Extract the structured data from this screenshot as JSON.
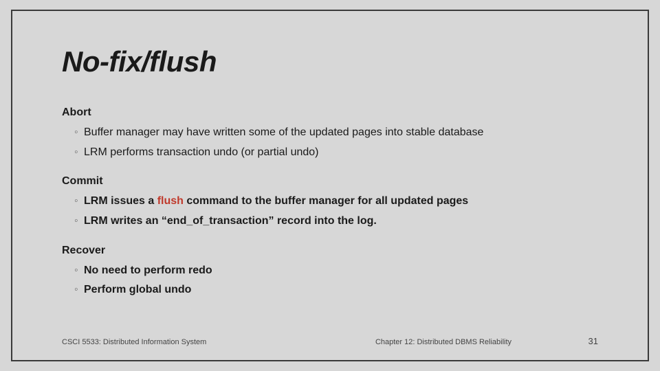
{
  "slide": {
    "title": "No-fix/flush",
    "sections": [
      {
        "heading": "Abort",
        "bullets": [
          {
            "text": "Buffer manager may have written some of the updated pages into stable database"
          },
          {
            "text": "LRM  performs transaction undo (or partial undo)"
          }
        ]
      },
      {
        "heading": "Commit",
        "bullets": [
          {
            "pre": "LRM issues a ",
            "em": "flush",
            "post": " command to the buffer manager for all updated pages",
            "bold": true
          },
          {
            "text": "LRM writes an “end_of_transaction” record into the log.",
            "bold": true
          }
        ]
      },
      {
        "heading": "Recover",
        "bullets": [
          {
            "text": "No need to perform  redo",
            "bold": true
          },
          {
            "text": "Perform global undo",
            "bold": true
          }
        ]
      }
    ],
    "footer": {
      "left": "CSCI 5533: Distributed Information System",
      "center": "Chapter 12: Distributed DBMS Reliability",
      "page": "31"
    }
  }
}
